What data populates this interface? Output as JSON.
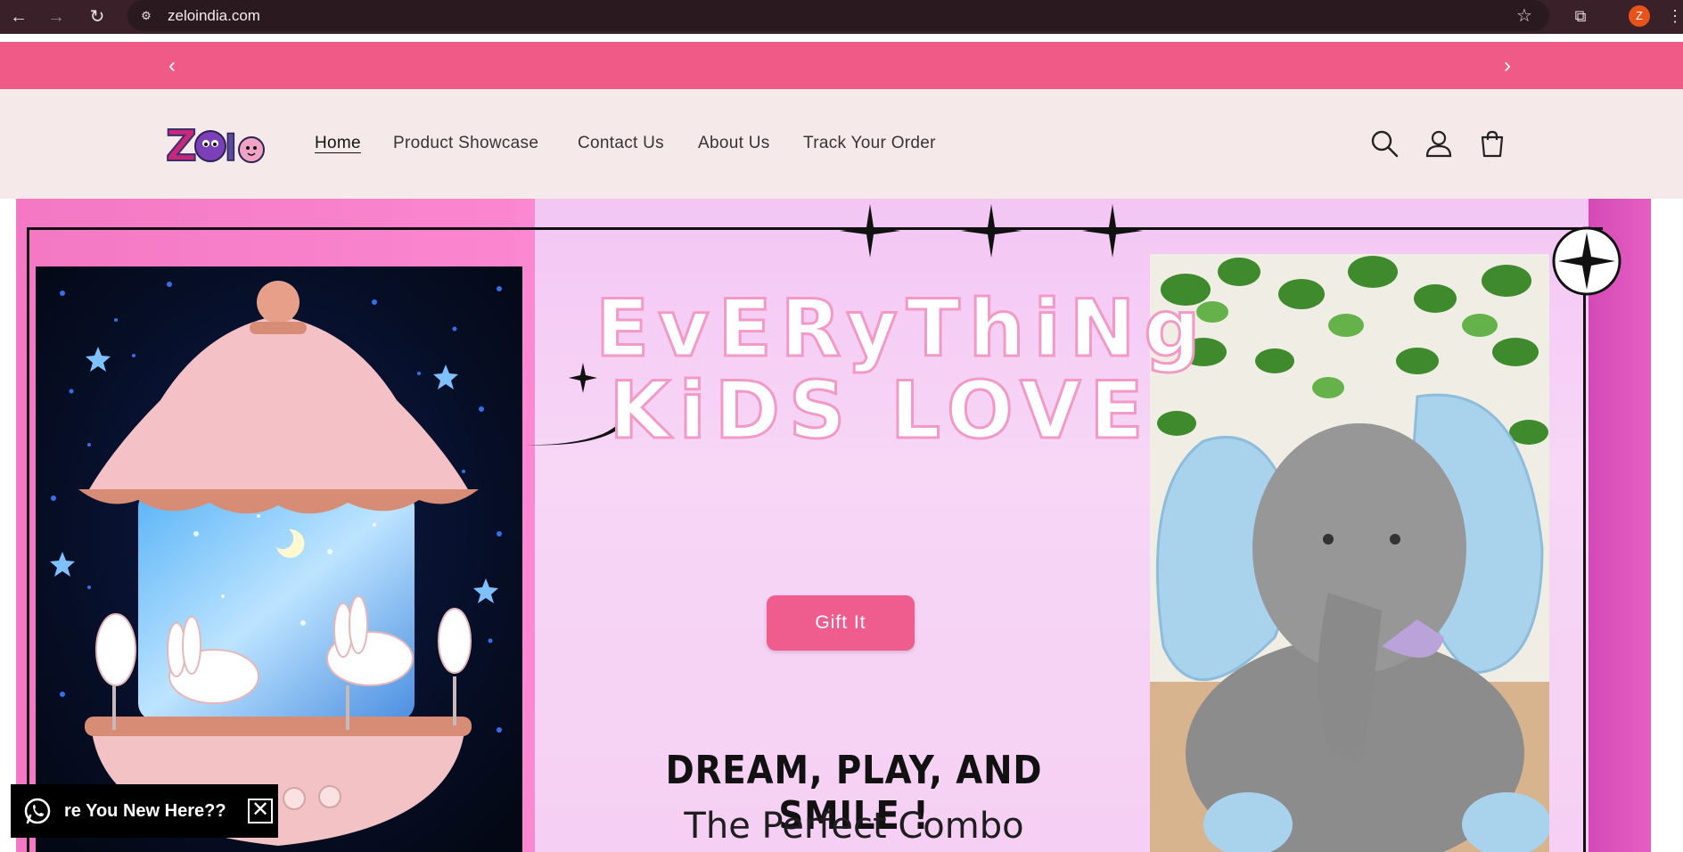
{
  "browser": {
    "url": "zeloindia.com",
    "back_icon": "back-arrow-icon",
    "forward_icon": "forward-arrow-icon",
    "reload_icon": "reload-icon",
    "profile_initial": "Z"
  },
  "announcement": {
    "prev_icon": "chevron-left-icon",
    "next_icon": "chevron-right-icon",
    "background": "#f05a86"
  },
  "header": {
    "logo_text": "Zelo",
    "nav": [
      {
        "label": "Home",
        "active": true
      },
      {
        "label": "Product Showcase"
      },
      {
        "label": "Contact Us"
      },
      {
        "label": "About Us"
      },
      {
        "label": "Track Your Order"
      }
    ],
    "icons": [
      "search-icon",
      "account-icon",
      "cart-icon"
    ]
  },
  "hero": {
    "headline_line1": "EvERyThiNg",
    "headline_line2": "KiDS LOVE",
    "cta_label": "Gift It",
    "tagline": "DREAM, PLAY, AND SMILE !",
    "subtagline": "The Perfect Combo",
    "accent_color": "#ee5d8e"
  },
  "whatsapp_popup": {
    "text": "re You New Here??",
    "close_label": "✕"
  }
}
